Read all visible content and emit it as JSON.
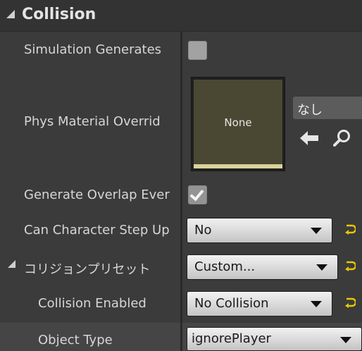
{
  "section": {
    "title": "Collision"
  },
  "rows": {
    "simulation_generates": {
      "label": "Simulation Generates",
      "checked": false
    },
    "phys_material": {
      "label": "Phys Material Overrid",
      "thumbnail_text": "None",
      "asset_value": "なし"
    },
    "generate_overlap": {
      "label": "Generate Overlap Ever",
      "checked": true
    },
    "can_character_step": {
      "label": "Can Character Step Up",
      "value": "No"
    },
    "collision_preset": {
      "label": "コリジョンプリセット",
      "value": "Custom..."
    },
    "collision_enabled": {
      "label": "Collision Enabled",
      "value": "No Collision"
    },
    "object_type": {
      "label": "Object Type",
      "value": "ignorePlayer"
    }
  },
  "colors": {
    "panel_bg": "#3b3b3b",
    "header_bg": "#333333",
    "reset_arrow": "#e8c800",
    "thumbnail_fill": "#4a4833",
    "thumbnail_bar": "#d9d29c"
  },
  "icons": {
    "section_toggle": "expand-triangle-icon",
    "browse": "arrow-left-icon",
    "find": "search-icon",
    "reset": "reset-to-default-icon"
  }
}
